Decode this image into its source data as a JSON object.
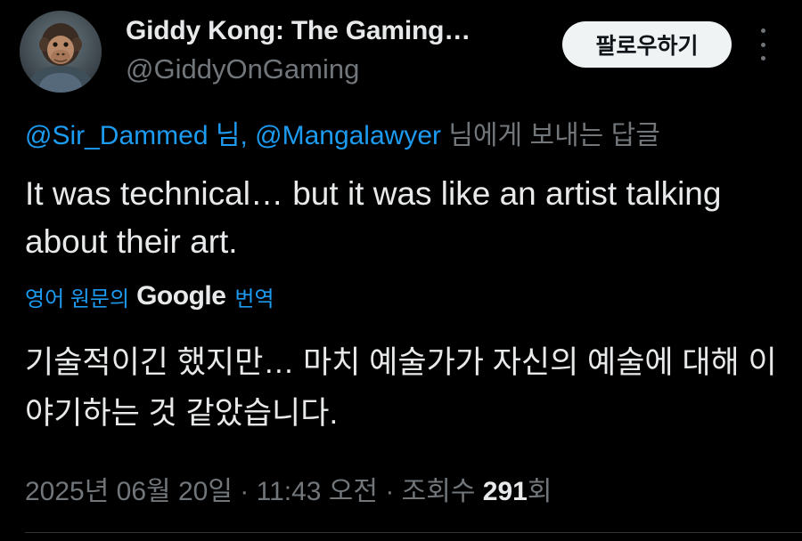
{
  "author": {
    "display_name": "Giddy Kong: The Gaming…",
    "handle": "@GiddyOnGaming",
    "avatar_icon": "chimpanzee-avatar"
  },
  "follow_button": {
    "label": "팔로우하기"
  },
  "more_icon": "more-vertical-icon",
  "reply_context": {
    "mention_1": "@Sir_Dammed",
    "separator": " 님, ",
    "mention_2": "@Mangalawyer",
    "suffix": " 님에게 보내는 답글"
  },
  "tweet": {
    "text": "It was technical… but it was like an artist talking about their art."
  },
  "translation": {
    "prefix": "영어 원문의",
    "provider": "Google",
    "suffix": "번역",
    "text": "기술적이긴 했지만… 마치 예술가가 자신의 예술에 대해 이야기하는 것 같았습니다."
  },
  "meta": {
    "timestamp": "2025년 06월 20일 · 11:43 오전 · 조회수 ",
    "views": "291",
    "views_unit": "회"
  },
  "colors": {
    "background": "#000000",
    "text_primary": "#e7e9ea",
    "text_secondary": "#71767b",
    "accent": "#1d9bf0",
    "button_bg": "#eff3f4",
    "divider": "#2f3336"
  }
}
